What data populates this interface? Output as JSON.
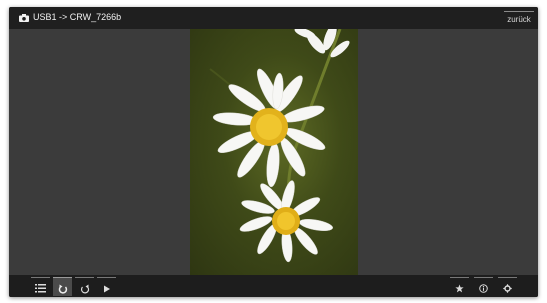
{
  "header": {
    "title": "USB1 -> CRW_7266b",
    "title_icon": "camera-icon",
    "back_label": "zurück"
  },
  "toolbar_left": [
    {
      "name": "list-view-icon",
      "active": false
    },
    {
      "name": "rotate-left-icon",
      "active": true
    },
    {
      "name": "rotate-right-icon",
      "active": false
    },
    {
      "name": "play-icon",
      "active": false
    }
  ],
  "toolbar_right": [
    {
      "name": "star-icon"
    },
    {
      "name": "info-icon"
    },
    {
      "name": "settings-gear-icon"
    }
  ],
  "colors": {
    "background": "#3b3b3b",
    "bars": "#1f1f1f",
    "text": "#f2f2f2"
  }
}
